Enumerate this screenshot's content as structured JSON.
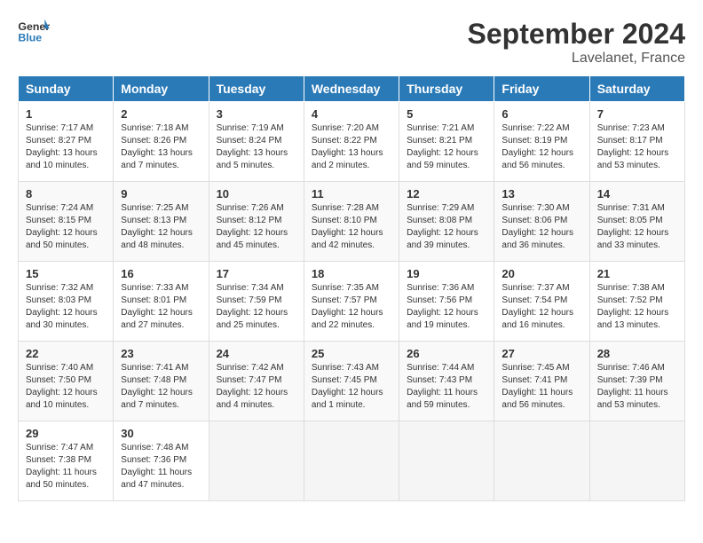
{
  "header": {
    "logo_line1": "General",
    "logo_line2": "Blue",
    "month": "September 2024",
    "location": "Lavelanet, France"
  },
  "days_of_week": [
    "Sunday",
    "Monday",
    "Tuesday",
    "Wednesday",
    "Thursday",
    "Friday",
    "Saturday"
  ],
  "weeks": [
    [
      {
        "day": "1",
        "sunrise": "Sunrise: 7:17 AM",
        "sunset": "Sunset: 8:27 PM",
        "daylight": "Daylight: 13 hours and 10 minutes."
      },
      {
        "day": "2",
        "sunrise": "Sunrise: 7:18 AM",
        "sunset": "Sunset: 8:26 PM",
        "daylight": "Daylight: 13 hours and 7 minutes."
      },
      {
        "day": "3",
        "sunrise": "Sunrise: 7:19 AM",
        "sunset": "Sunset: 8:24 PM",
        "daylight": "Daylight: 13 hours and 5 minutes."
      },
      {
        "day": "4",
        "sunrise": "Sunrise: 7:20 AM",
        "sunset": "Sunset: 8:22 PM",
        "daylight": "Daylight: 13 hours and 2 minutes."
      },
      {
        "day": "5",
        "sunrise": "Sunrise: 7:21 AM",
        "sunset": "Sunset: 8:21 PM",
        "daylight": "Daylight: 12 hours and 59 minutes."
      },
      {
        "day": "6",
        "sunrise": "Sunrise: 7:22 AM",
        "sunset": "Sunset: 8:19 PM",
        "daylight": "Daylight: 12 hours and 56 minutes."
      },
      {
        "day": "7",
        "sunrise": "Sunrise: 7:23 AM",
        "sunset": "Sunset: 8:17 PM",
        "daylight": "Daylight: 12 hours and 53 minutes."
      }
    ],
    [
      {
        "day": "8",
        "sunrise": "Sunrise: 7:24 AM",
        "sunset": "Sunset: 8:15 PM",
        "daylight": "Daylight: 12 hours and 50 minutes."
      },
      {
        "day": "9",
        "sunrise": "Sunrise: 7:25 AM",
        "sunset": "Sunset: 8:13 PM",
        "daylight": "Daylight: 12 hours and 48 minutes."
      },
      {
        "day": "10",
        "sunrise": "Sunrise: 7:26 AM",
        "sunset": "Sunset: 8:12 PM",
        "daylight": "Daylight: 12 hours and 45 minutes."
      },
      {
        "day": "11",
        "sunrise": "Sunrise: 7:28 AM",
        "sunset": "Sunset: 8:10 PM",
        "daylight": "Daylight: 12 hours and 42 minutes."
      },
      {
        "day": "12",
        "sunrise": "Sunrise: 7:29 AM",
        "sunset": "Sunset: 8:08 PM",
        "daylight": "Daylight: 12 hours and 39 minutes."
      },
      {
        "day": "13",
        "sunrise": "Sunrise: 7:30 AM",
        "sunset": "Sunset: 8:06 PM",
        "daylight": "Daylight: 12 hours and 36 minutes."
      },
      {
        "day": "14",
        "sunrise": "Sunrise: 7:31 AM",
        "sunset": "Sunset: 8:05 PM",
        "daylight": "Daylight: 12 hours and 33 minutes."
      }
    ],
    [
      {
        "day": "15",
        "sunrise": "Sunrise: 7:32 AM",
        "sunset": "Sunset: 8:03 PM",
        "daylight": "Daylight: 12 hours and 30 minutes."
      },
      {
        "day": "16",
        "sunrise": "Sunrise: 7:33 AM",
        "sunset": "Sunset: 8:01 PM",
        "daylight": "Daylight: 12 hours and 27 minutes."
      },
      {
        "day": "17",
        "sunrise": "Sunrise: 7:34 AM",
        "sunset": "Sunset: 7:59 PM",
        "daylight": "Daylight: 12 hours and 25 minutes."
      },
      {
        "day": "18",
        "sunrise": "Sunrise: 7:35 AM",
        "sunset": "Sunset: 7:57 PM",
        "daylight": "Daylight: 12 hours and 22 minutes."
      },
      {
        "day": "19",
        "sunrise": "Sunrise: 7:36 AM",
        "sunset": "Sunset: 7:56 PM",
        "daylight": "Daylight: 12 hours and 19 minutes."
      },
      {
        "day": "20",
        "sunrise": "Sunrise: 7:37 AM",
        "sunset": "Sunset: 7:54 PM",
        "daylight": "Daylight: 12 hours and 16 minutes."
      },
      {
        "day": "21",
        "sunrise": "Sunrise: 7:38 AM",
        "sunset": "Sunset: 7:52 PM",
        "daylight": "Daylight: 12 hours and 13 minutes."
      }
    ],
    [
      {
        "day": "22",
        "sunrise": "Sunrise: 7:40 AM",
        "sunset": "Sunset: 7:50 PM",
        "daylight": "Daylight: 12 hours and 10 minutes."
      },
      {
        "day": "23",
        "sunrise": "Sunrise: 7:41 AM",
        "sunset": "Sunset: 7:48 PM",
        "daylight": "Daylight: 12 hours and 7 minutes."
      },
      {
        "day": "24",
        "sunrise": "Sunrise: 7:42 AM",
        "sunset": "Sunset: 7:47 PM",
        "daylight": "Daylight: 12 hours and 4 minutes."
      },
      {
        "day": "25",
        "sunrise": "Sunrise: 7:43 AM",
        "sunset": "Sunset: 7:45 PM",
        "daylight": "Daylight: 12 hours and 1 minute."
      },
      {
        "day": "26",
        "sunrise": "Sunrise: 7:44 AM",
        "sunset": "Sunset: 7:43 PM",
        "daylight": "Daylight: 11 hours and 59 minutes."
      },
      {
        "day": "27",
        "sunrise": "Sunrise: 7:45 AM",
        "sunset": "Sunset: 7:41 PM",
        "daylight": "Daylight: 11 hours and 56 minutes."
      },
      {
        "day": "28",
        "sunrise": "Sunrise: 7:46 AM",
        "sunset": "Sunset: 7:39 PM",
        "daylight": "Daylight: 11 hours and 53 minutes."
      }
    ],
    [
      {
        "day": "29",
        "sunrise": "Sunrise: 7:47 AM",
        "sunset": "Sunset: 7:38 PM",
        "daylight": "Daylight: 11 hours and 50 minutes."
      },
      {
        "day": "30",
        "sunrise": "Sunrise: 7:48 AM",
        "sunset": "Sunset: 7:36 PM",
        "daylight": "Daylight: 11 hours and 47 minutes."
      },
      null,
      null,
      null,
      null,
      null
    ]
  ]
}
